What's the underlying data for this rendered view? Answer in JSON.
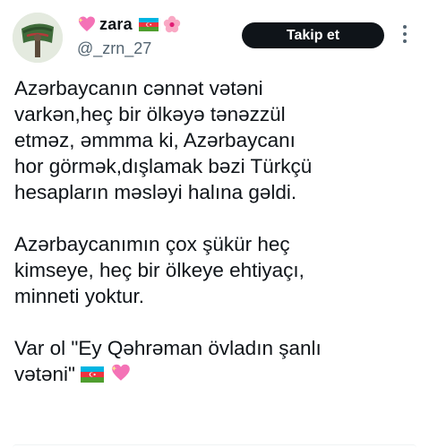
{
  "author": {
    "display_name": "zara",
    "handle": "@_zrn_27"
  },
  "actions": {
    "follow_label": "Takip et"
  },
  "tweet": {
    "paragraph1_lines": [
      "Azərbaycanın cənnət vətəni",
      "varkən,heç bir ölkəyə tənəzzül",
      "etməz, əmmma ki, Azərbaycanı",
      "hor görmək,dışlamak bəzi Türkçü",
      "hesapların məsləyi halına gəldi."
    ],
    "paragraph2_lines": [
      "Azərbaycanımın çox şükür heç",
      "kimseye, heç bir ölkeye ehtiyaçı,",
      "minneti yoktur."
    ],
    "paragraph3_line1": "Var ol \"Ey Qəhrəman övladın şanlı",
    "paragraph3_line2": "vətəni\""
  },
  "icons": {
    "name_prefix": "sparkling-heart-icon",
    "name_suffix": [
      "azerbaijan-flag-icon",
      "hibiscus-icon"
    ],
    "text_end": [
      "azerbaijan-flag-icon",
      "sparkling-heart-icon"
    ],
    "menu": "more-dots-icon"
  },
  "colors": {
    "follow_button_bg": "#0f1419",
    "handle_text": "#536471",
    "flag_blue": "#00b5e2",
    "flag_red": "#ef3340",
    "flag_green": "#509e2f",
    "heart_pink": "#f472b6"
  }
}
